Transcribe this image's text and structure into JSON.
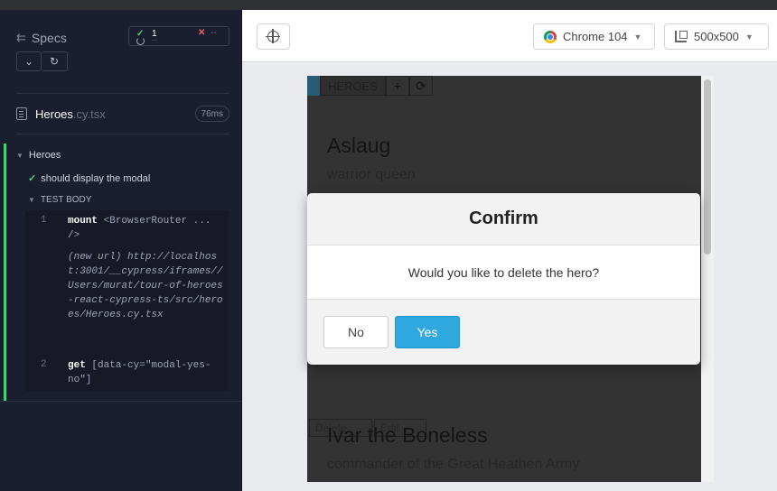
{
  "reporter": {
    "specs_label": "Specs",
    "stats": {
      "passed_count": "1",
      "failed_count": "--",
      "pending_count": "--"
    },
    "file": {
      "name": "Heroes",
      "ext": ".cy.tsx",
      "duration": "76ms"
    },
    "suite": {
      "title": "Heroes",
      "test_title": "should display the modal",
      "body_label": "TEST BODY",
      "commands": [
        {
          "num": "1",
          "name": "mount",
          "arg": "<BrowserRouter ... />",
          "sub": "(new url)",
          "url": "http://localhost:3001/__cypress/iframes//Users/murat/tour-of-heroes-react-cypress-ts/src/heroes/Heroes.cy.tsx"
        },
        {
          "num": "2",
          "name": "get",
          "arg": "[data-cy=\"modal-yes-no\"]"
        }
      ]
    }
  },
  "toolbar": {
    "browser": "Chrome 104",
    "viewport": "500x500"
  },
  "app": {
    "list_title": "HEROES",
    "add_icon": "+",
    "refresh_icon": "⟳",
    "heroes": [
      {
        "name": "Aslaug",
        "description": "warrior queen"
      },
      {
        "name": "Ivar the Boneless",
        "description": "commander of the Great Heathen Army"
      }
    ],
    "hero_buttons": [
      "Delete",
      "Edit"
    ],
    "modal": {
      "title": "Confirm",
      "message": "Would you like to delete the hero?",
      "no_label": "No",
      "yes_label": "Yes"
    }
  },
  "colors": {
    "pass": "#3ed37a",
    "fail": "#f15b6b",
    "accent": "#2fa8e0"
  }
}
